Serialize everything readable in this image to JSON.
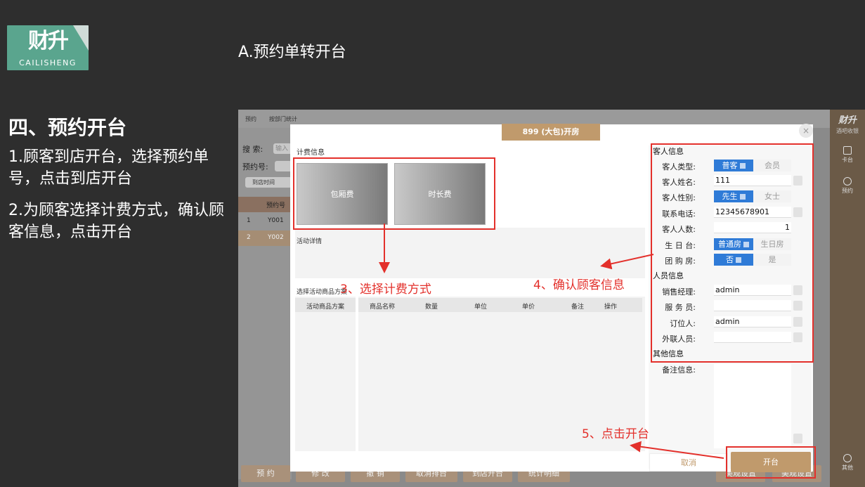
{
  "logo": {
    "mark": "财升",
    "subtitle": "CAILISHENG"
  },
  "slide_title": "A.预约单转开台",
  "section_title": "四、预约开台",
  "steps": [
    "1.顾客到店开台，选择预约单号，点击到店开台",
    "2.为顾客选择计费方式，确认顾客信息，点击开台"
  ],
  "app": {
    "tabs": [
      "预约",
      "按部门统计"
    ],
    "search_label": "搜 索:",
    "search_placeholder": "输入",
    "order_label": "预约号:",
    "time_filter": "到店时间",
    "col_order_no": "预约号",
    "rows": [
      {
        "idx": "1",
        "order_no": "Y001"
      },
      {
        "idx": "2",
        "order_no": "Y002"
      }
    ],
    "bottom_buttons": [
      "预 约",
      "修 改",
      "撤 销",
      "取消排台",
      "到店开台",
      "统计明细",
      "美观设置",
      "美观设置"
    ]
  },
  "rail": {
    "brand": "财升",
    "brand_sub": "酒吧收银",
    "items": [
      "卡台",
      "预约",
      "其他"
    ]
  },
  "modal": {
    "title": "899 (大包)开房",
    "close": "×",
    "fee_section": "计费信息",
    "fee_options": [
      "包厢费",
      "时长费"
    ],
    "activity_detail": "活动详情",
    "select_plan": "选择活动商品方案",
    "plan_header": "活动商品方案",
    "table_headers": [
      "商品名称",
      "数量",
      "单位",
      "单价",
      "备注",
      "操作"
    ],
    "customer_section": "客人信息",
    "staff_section": "人员信息",
    "other_section": "其他信息",
    "fields": {
      "customer_type": {
        "label": "客人类型:",
        "options": [
          "普客",
          "会员"
        ],
        "selected": "普客"
      },
      "customer_name": {
        "label": "客人姓名:",
        "value": "111"
      },
      "gender": {
        "label": "客人性别:",
        "options": [
          "先生",
          "女士"
        ],
        "selected": "先生"
      },
      "phone": {
        "label": "联系电话:",
        "value": "12345678901"
      },
      "count": {
        "label": "客人人数:",
        "value": "1"
      },
      "birthday": {
        "label": "生 日 台:",
        "options": [
          "普通房",
          "生日房"
        ],
        "selected": "普通房"
      },
      "group_buy": {
        "label": "团 购 房:",
        "options": [
          "否",
          "是"
        ],
        "selected": "否"
      },
      "sales_manager": {
        "label": "销售经理:",
        "value": "admin"
      },
      "waiter": {
        "label": "服 务 员:",
        "value": ""
      },
      "booker": {
        "label": "订位人:",
        "value": "admin"
      },
      "contact": {
        "label": "外联人员:",
        "value": ""
      },
      "remark": {
        "label": "备注信息:",
        "value": ""
      }
    },
    "cancel": "取消",
    "open": "开台"
  },
  "annotations": {
    "a3": "3、选择计费方式",
    "a4": "4、确认顾客信息",
    "a5": "5、点击开台"
  },
  "colors": {
    "accent": "#c09a6c",
    "annotation": "#e3302b",
    "toggle_on": "#2f7bd7"
  }
}
